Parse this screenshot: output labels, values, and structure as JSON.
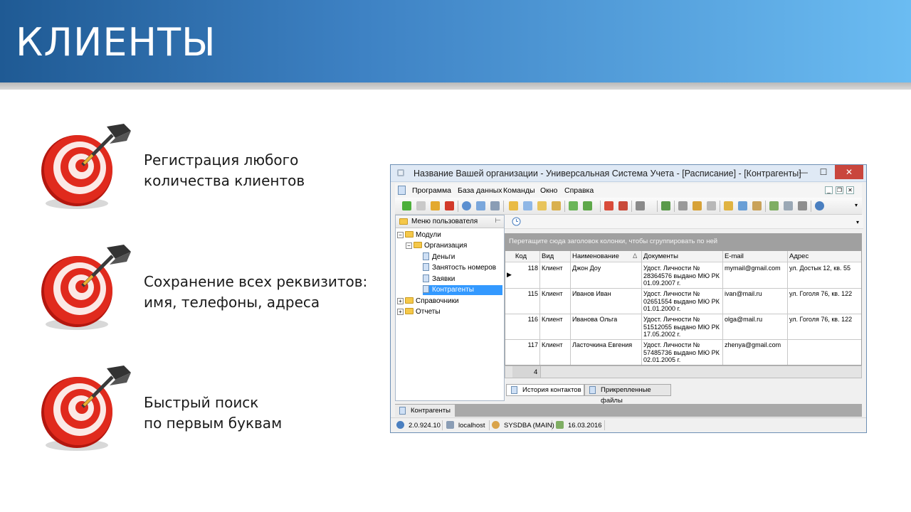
{
  "slide": {
    "title": "КЛИЕНТЫ",
    "bullets": [
      {
        "line1": "Регистрация любого",
        "line2": "количества клиентов",
        "icon": "target-dart-icon"
      },
      {
        "line1": "Сохранение всех реквизитов:",
        "line2": "имя, телефоны, адреса",
        "icon": "target-dart-icon"
      },
      {
        "line1": "Быстрый поиск",
        "line2": "по первым буквам",
        "icon": "target-dart-icon"
      }
    ],
    "colors": {
      "banner_start": "#1f5a94",
      "banner_end": "#6bbcf2",
      "target_red": "#e02a1d"
    }
  },
  "window": {
    "title": "Название Вашей организации - Универсальная Система Учета - [Расписание] - [Контрагенты]",
    "menu": [
      "Программа",
      "База данных",
      "Команды",
      "Окно",
      "Справка"
    ],
    "left_panel": {
      "header": "Меню пользователя",
      "tree": {
        "modules": "Модули",
        "organization": "Организация",
        "money": "Деньги",
        "rooms": "Занятость номеров",
        "requests": "Заявки",
        "contractors": "Контрагенты",
        "references": "Справочники",
        "reports": "Отчеты"
      }
    },
    "grid": {
      "group_hint": "Перетащите сюда заголовок колонки, чтобы сгруппировать по ней",
      "columns": {
        "code": "Код",
        "kind": "Вид",
        "name": "Наименование",
        "sort": "∆",
        "docs": "Документы",
        "email": "E-mail",
        "address": "Адрес"
      },
      "rows": [
        {
          "code": "118",
          "kind": "Клиент",
          "name": "Джон Доу",
          "doc1": "Удост. Личности №",
          "doc2": "28364576 выдано МЮ РК",
          "doc3": "01.09.2007 г.",
          "email": "mymail@gmail.com",
          "address": "ул. Достык 12, кв. 55"
        },
        {
          "code": "115",
          "kind": "Клиент",
          "name": "Иванов Иван",
          "doc1": "Удост. Личности №",
          "doc2": "02651554 выдано МЮ РК",
          "doc3": "01.01.2000 г.",
          "email": "ivan@mail.ru",
          "address": "ул. Гоголя 76, кв. 122"
        },
        {
          "code": "116",
          "kind": "Клиент",
          "name": "Иванова Ольга",
          "doc1": "Удост. Личности №",
          "doc2": "51512055 выдано МЮ РК",
          "doc3": "17.05.2002 г.",
          "email": "olga@mail.ru",
          "address": "ул. Гоголя 76, кв. 122"
        },
        {
          "code": "117",
          "kind": "Клиент",
          "name": "Ласточкина Евгения",
          "doc1": "Удост. Личности №",
          "doc2": "57485736 выдано МЮ РК",
          "doc3": "02.01.2005 г.",
          "email": "zhenya@gmail.com",
          "address": ""
        }
      ],
      "row_count": "4"
    },
    "tabs": [
      "История контактов",
      "Прикрепленные файлы"
    ],
    "mdi_tab": "Контрагенты",
    "status": {
      "version": "2.0.924.10",
      "host": "localhost",
      "user": "SYSDBA (MAIN)",
      "date": "16.03.2016"
    }
  }
}
